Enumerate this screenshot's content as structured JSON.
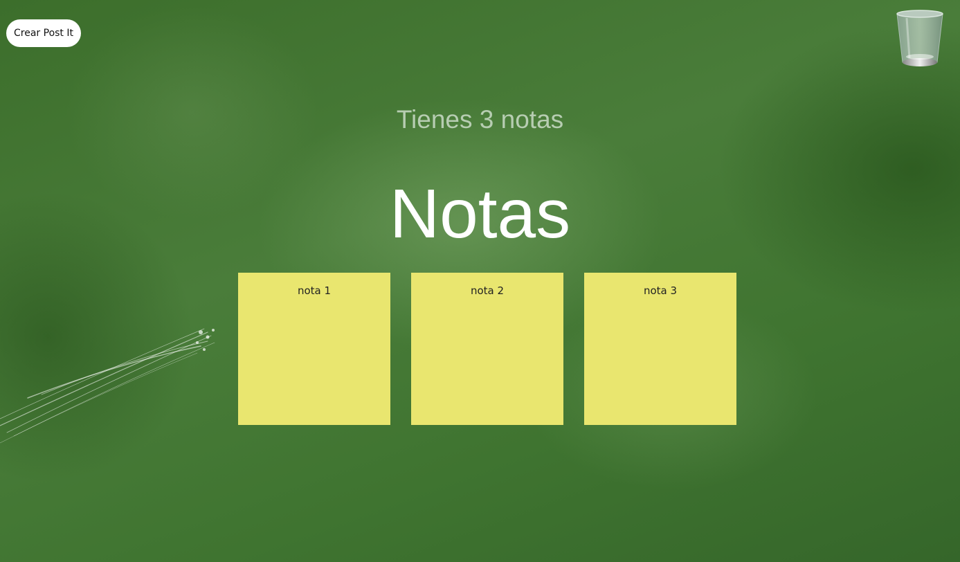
{
  "toolbar": {
    "create_label": "Crear Post It"
  },
  "trash": {
    "icon": "trash-bin-icon"
  },
  "header": {
    "count_text": "Tienes 3 notas",
    "title": "Notas"
  },
  "notes": [
    {
      "text": "nota 1"
    },
    {
      "text": "nota 2"
    },
    {
      "text": "nota 3"
    }
  ],
  "colors": {
    "board": "#3d6e2c",
    "note": "#e9e66f",
    "button": "#ffffff"
  }
}
